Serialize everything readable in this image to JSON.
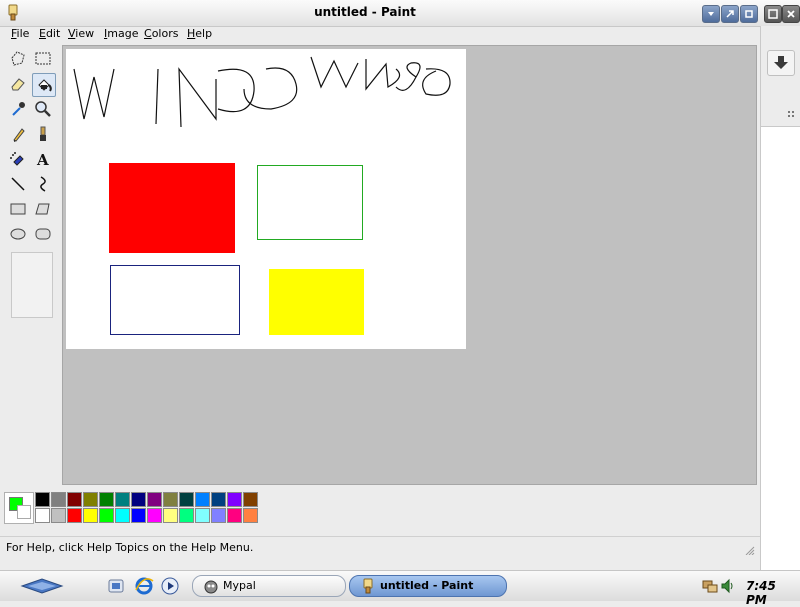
{
  "window": {
    "title": "untitled - Paint"
  },
  "menu": [
    "File",
    "Edit",
    "View",
    "Image",
    "Colors",
    "Help"
  ],
  "tools": [
    "free-select",
    "rect-select",
    "eraser",
    "fill",
    "color-picker",
    "magnifier",
    "pencil",
    "brush",
    "airbrush",
    "text",
    "line",
    "curve",
    "rectangle",
    "polygon",
    "ellipse",
    "rounded-rectangle"
  ],
  "selected_tool": "fill",
  "canvas": {
    "drawing": "hand-drawn scribble reading WINDOWS",
    "shapes": [
      {
        "kind": "filled-rectangle",
        "fill": "#ff0000"
      },
      {
        "kind": "outlined-rectangle",
        "stroke": "#22aa22"
      },
      {
        "kind": "outlined-rectangle",
        "stroke": "#1a237e"
      },
      {
        "kind": "filled-rectangle",
        "fill": "#ffff00"
      }
    ]
  },
  "palette": {
    "foreground": "#00ff00",
    "background": "#ffffff",
    "row1": [
      "#000000",
      "#808080",
      "#800000",
      "#808000",
      "#008000",
      "#008080",
      "#000080",
      "#800080",
      "#808040",
      "#004040",
      "#0080ff",
      "#004080",
      "#8000ff",
      "#804000"
    ],
    "row2": [
      "#ffffff",
      "#c0c0c0",
      "#ff0000",
      "#ffff00",
      "#00ff00",
      "#00ffff",
      "#0000ff",
      "#ff00ff",
      "#ffff80",
      "#00ff80",
      "#80ffff",
      "#8080ff",
      "#ff0080",
      "#ff8040"
    ]
  },
  "status": {
    "text": "For Help, click Help Topics on the Help Menu."
  },
  "taskbar": {
    "tasks": [
      {
        "label": "Mypal",
        "active": false
      },
      {
        "label": "untitled - Paint",
        "active": true
      }
    ],
    "clock": "7:45 PM"
  }
}
